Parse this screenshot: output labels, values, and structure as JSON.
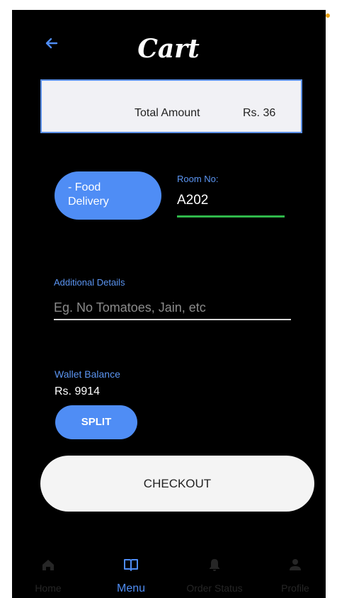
{
  "header": {
    "title": "Cart"
  },
  "summary": {
    "total_label": "Total Amount",
    "total_value": "Rs. 36"
  },
  "delivery": {
    "label_line1": "- Food",
    "label_line2": "Delivery"
  },
  "room": {
    "label": "Room No:",
    "value": "A202"
  },
  "details": {
    "label": "Additional Details",
    "placeholder": "Eg. No Tomatoes, Jain, etc"
  },
  "wallet": {
    "label": "Wallet Balance",
    "value": "Rs. 9914"
  },
  "buttons": {
    "split": "SPLIT",
    "checkout": "CHECKOUT"
  },
  "nav": {
    "items": [
      {
        "label": "Home",
        "icon": "home-icon"
      },
      {
        "label": "Menu",
        "icon": "book-icon"
      },
      {
        "label": "Order Status",
        "icon": "bell-icon"
      },
      {
        "label": "Profile",
        "icon": "person-icon"
      }
    ],
    "active_index": 1
  },
  "colors": {
    "accent": "#4f8df5",
    "underline_active": "#2fb84a",
    "background": "#000000",
    "status_dot": "#e7a21a"
  }
}
